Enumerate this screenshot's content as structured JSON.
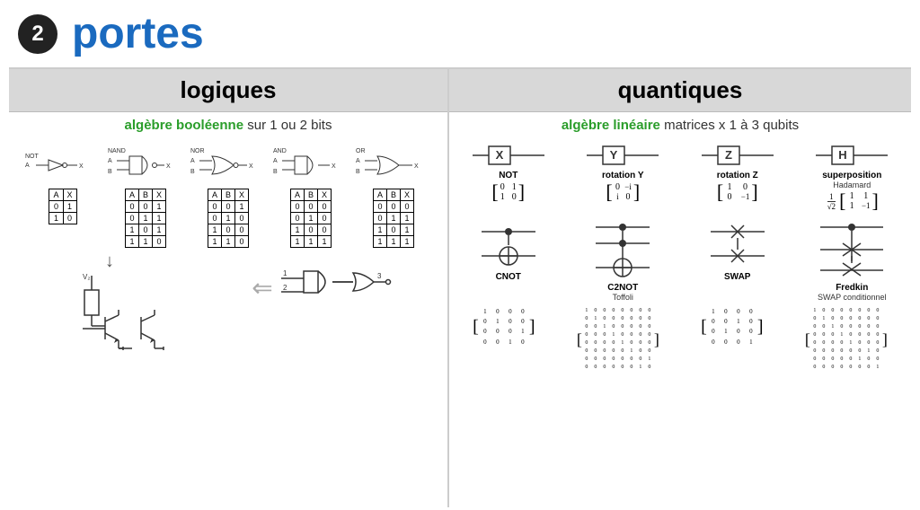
{
  "header": {
    "badge": "2",
    "title": "portes"
  },
  "columns": {
    "logiques": {
      "header": "logiques",
      "subheader_green": "algèbre booléenne",
      "subheader_rest": " sur 1 ou 2 bits"
    },
    "quantiques": {
      "header": "quantiques",
      "subheader_green": "algèbre linéaire",
      "subheader_rest": " matrices x 1 à 3 qubits"
    }
  },
  "logic_gates": [
    {
      "name": "NOT",
      "label": "NOT"
    },
    {
      "name": "NAND",
      "label": "NAND"
    },
    {
      "name": "NOR",
      "label": "NOR"
    },
    {
      "name": "AND",
      "label": "AND"
    },
    {
      "name": "OR",
      "label": "OR"
    }
  ],
  "quantum_gates": [
    {
      "symbol": "X",
      "label": "NOT",
      "sublabel": "",
      "matrix": [
        "0",
        "1",
        "1",
        "0"
      ]
    },
    {
      "symbol": "Y",
      "label": "rotation Y",
      "sublabel": "",
      "matrix": [
        "0",
        "-i",
        "i",
        "0"
      ]
    },
    {
      "symbol": "Z",
      "label": "rotation Z",
      "sublabel": "",
      "matrix": [
        "1",
        "0",
        "0",
        "-1"
      ]
    },
    {
      "symbol": "H",
      "label": "superposition",
      "sublabel": "Hadamard",
      "matrix": [
        "1",
        "1",
        "1",
        "-1"
      ]
    }
  ],
  "quantum_gates2": [
    {
      "symbol": "CNOT",
      "label": "CNOT",
      "sublabel": ""
    },
    {
      "symbol": "C2NOT",
      "label": "C2NOT",
      "sublabel": "Toffoli"
    },
    {
      "symbol": "SWAP",
      "label": "SWAP",
      "sublabel": ""
    },
    {
      "symbol": "Fredkin",
      "label": "Fredkin",
      "sublabel": "SWAP conditionnel"
    }
  ]
}
